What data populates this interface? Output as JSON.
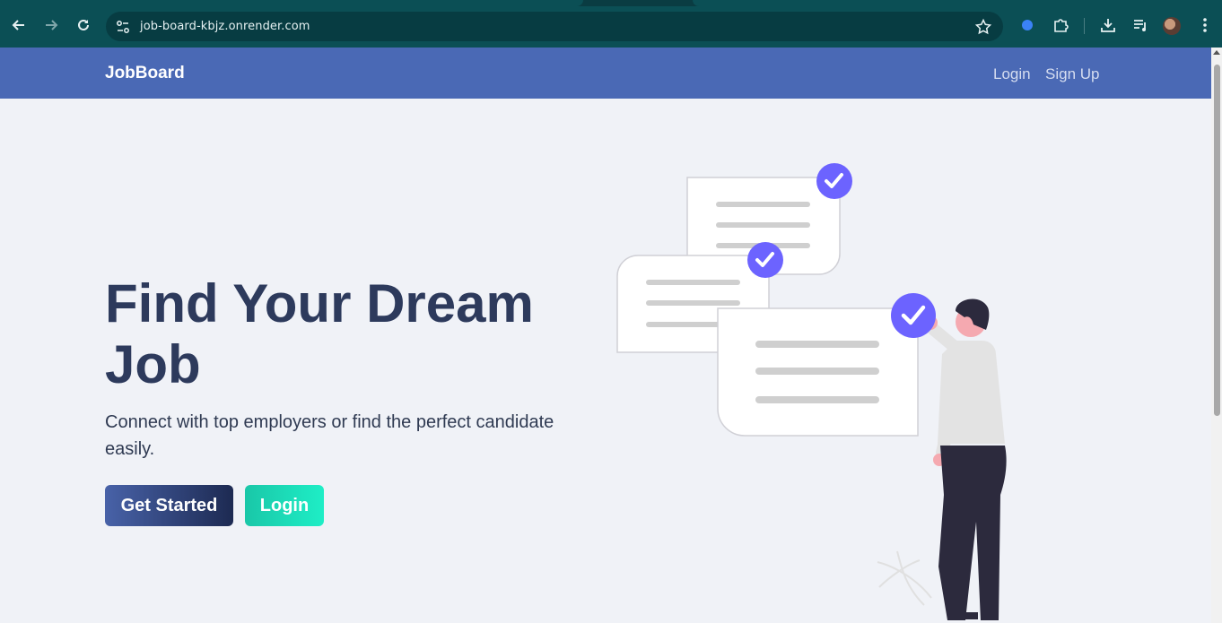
{
  "browser": {
    "url": "job-board-kbjz.onrender.com",
    "icons": {
      "back": "back-arrow-icon",
      "forward": "forward-arrow-icon",
      "reload": "reload-icon",
      "site_info": "site-info-icon",
      "bookmark": "star-icon",
      "extension_dot": "blue-dot-icon",
      "extensions": "puzzle-icon",
      "downloads": "download-icon",
      "media": "media-control-icon",
      "profile": "avatar",
      "menu": "kebab-menu-icon"
    }
  },
  "navbar": {
    "brand": "JobBoard",
    "links": [
      {
        "label": "Login"
      },
      {
        "label": "Sign Up"
      }
    ],
    "color": "#4a69b5"
  },
  "hero": {
    "title": "Find Your Dream Job",
    "subtitle": "Connect with top employers or find the perfect candidate easily.",
    "buttons": {
      "primary": "Get Started",
      "secondary": "Login"
    }
  },
  "colors": {
    "accent_purple": "#6c63ff",
    "title": "#2d3a5c",
    "teal": "#1ad8b8"
  }
}
